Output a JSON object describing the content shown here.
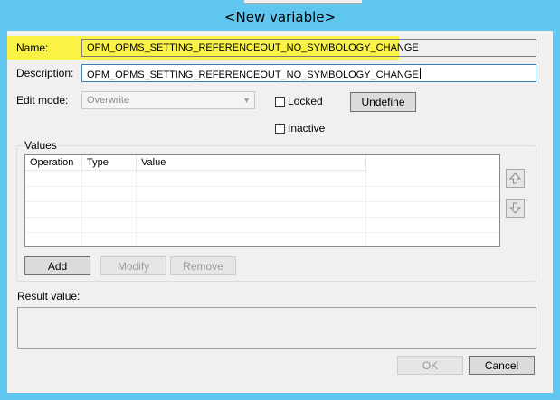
{
  "dialog": {
    "title": "<New variable>"
  },
  "form": {
    "name_label": "Name:",
    "name_value": "OPM_OPMS_SETTING_REFERENCEOUT_NO_SYMBOLOGY_CHANGE",
    "description_label": "Description:",
    "description_value": "OPM_OPMS_SETTING_REFERENCEOUT_NO_SYMBOLOGY_CHANGE",
    "edit_mode_label": "Edit mode:",
    "edit_mode_value": "Overwrite",
    "locked_label": "Locked",
    "inactive_label": "Inactive",
    "undefine_label": "Undefine"
  },
  "values": {
    "group_title": "Values",
    "columns": [
      "Operation",
      "Type",
      "Value"
    ],
    "add_label": "Add",
    "modify_label": "Modify",
    "remove_label": "Remove"
  },
  "result": {
    "label": "Result value:"
  },
  "footer": {
    "ok_label": "OK",
    "cancel_label": "Cancel"
  },
  "colors": {
    "titlebar": "#5fc6ef",
    "highlight": "#faf346",
    "client": "#f0f0f0"
  },
  "icons": {
    "move_up": "up-arrow-icon",
    "move_down": "down-arrow-icon"
  }
}
